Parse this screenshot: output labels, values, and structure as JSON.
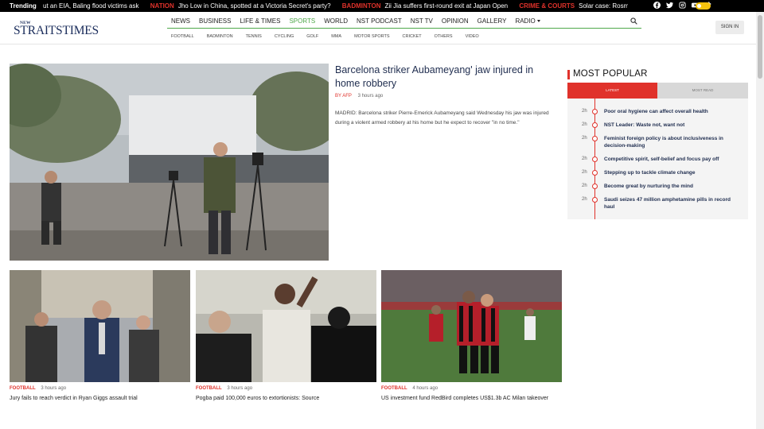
{
  "trending": {
    "label": "Trending",
    "items": [
      {
        "category": "",
        "headline": "ut an EIA, Baling flood victims ask"
      },
      {
        "category": "NATION",
        "headline": "Jho Low in China, spotted at a Victoria Secret's party?"
      },
      {
        "category": "BADMINTON",
        "headline": "Zii Jia suffers first-round exit at Japan Open"
      },
      {
        "category": "CRIME & COURTS",
        "headline": "Solar case: Rosmah"
      }
    ]
  },
  "social_icons": [
    "facebook-icon",
    "twitter-icon",
    "instagram-icon",
    "youtube-icon",
    "tiktok-icon"
  ],
  "logo": {
    "small": "NEW",
    "big": "STRAITSTIMES"
  },
  "nav": {
    "items": [
      {
        "label": "NEWS",
        "active": false
      },
      {
        "label": "BUSINESS",
        "active": false
      },
      {
        "label": "LIFE & TIMES",
        "active": false
      },
      {
        "label": "SPORTS",
        "active": true
      },
      {
        "label": "WORLD",
        "active": false
      },
      {
        "label": "NST PODCAST",
        "active": false
      },
      {
        "label": "NST TV",
        "active": false
      },
      {
        "label": "OPINION",
        "active": false
      },
      {
        "label": "GALLERY",
        "active": false
      },
      {
        "label": "RADIO",
        "active": false
      }
    ],
    "sub_items": [
      "FOOTBALL",
      "BADMINTON",
      "TENNIS",
      "CYCLING",
      "GOLF",
      "MMA",
      "MOTOR SPORTS",
      "CRICKET",
      "OTHERS",
      "VIDEO"
    ],
    "signin_label": "SIGN IN"
  },
  "hero": {
    "title": "Barcelona striker Aubameyang' jaw injured in home robbery",
    "byline": "BY AFP",
    "time": "3 hours ago",
    "summary": "MADRID: Barcelona striker Pierre-Emerick Aubameyang said Wednesday his jaw was injured during a violent armed robbery at his home but he expect to recover \"in no time.\""
  },
  "most_popular": {
    "title": "MOST POPULAR",
    "tabs": {
      "latest": "LATEST",
      "most_read": "MOST READ"
    },
    "items": [
      {
        "time": "2h",
        "headline": "Poor oral hygiene can affect overall health"
      },
      {
        "time": "2h",
        "headline": "NST Leader: Waste not, want not"
      },
      {
        "time": "2h",
        "headline": "Feminist foreign policy is about inclusiveness in decision-making"
      },
      {
        "time": "2h",
        "headline": "Competitive spirit, self-belief and focus pay off"
      },
      {
        "time": "2h",
        "headline": "Stepping up to tackle climate change"
      },
      {
        "time": "2h",
        "headline": "Become great by nurturing the mind"
      },
      {
        "time": "2h",
        "headline": "Saudi seizes 47 million amphetamine pills in record haul"
      }
    ]
  },
  "cards": [
    {
      "category": "FOOTBALL",
      "time": "3 hours ago",
      "title": "Jury fails to reach verdict in Ryan Giggs assault trial"
    },
    {
      "category": "FOOTBALL",
      "time": "3 hours ago",
      "title": "Pogba paid 100,000 euros to extortionists: Source"
    },
    {
      "category": "FOOTBALL",
      "time": "4 hours ago",
      "title": "US investment fund RedBird completes US$1.3b AC Milan takeover"
    }
  ],
  "colors": {
    "accent_red": "#e0322b",
    "nav_active_green": "#4fa84a",
    "logo_navy": "#1a2c5b",
    "headline_navy": "#1f2d4f"
  }
}
